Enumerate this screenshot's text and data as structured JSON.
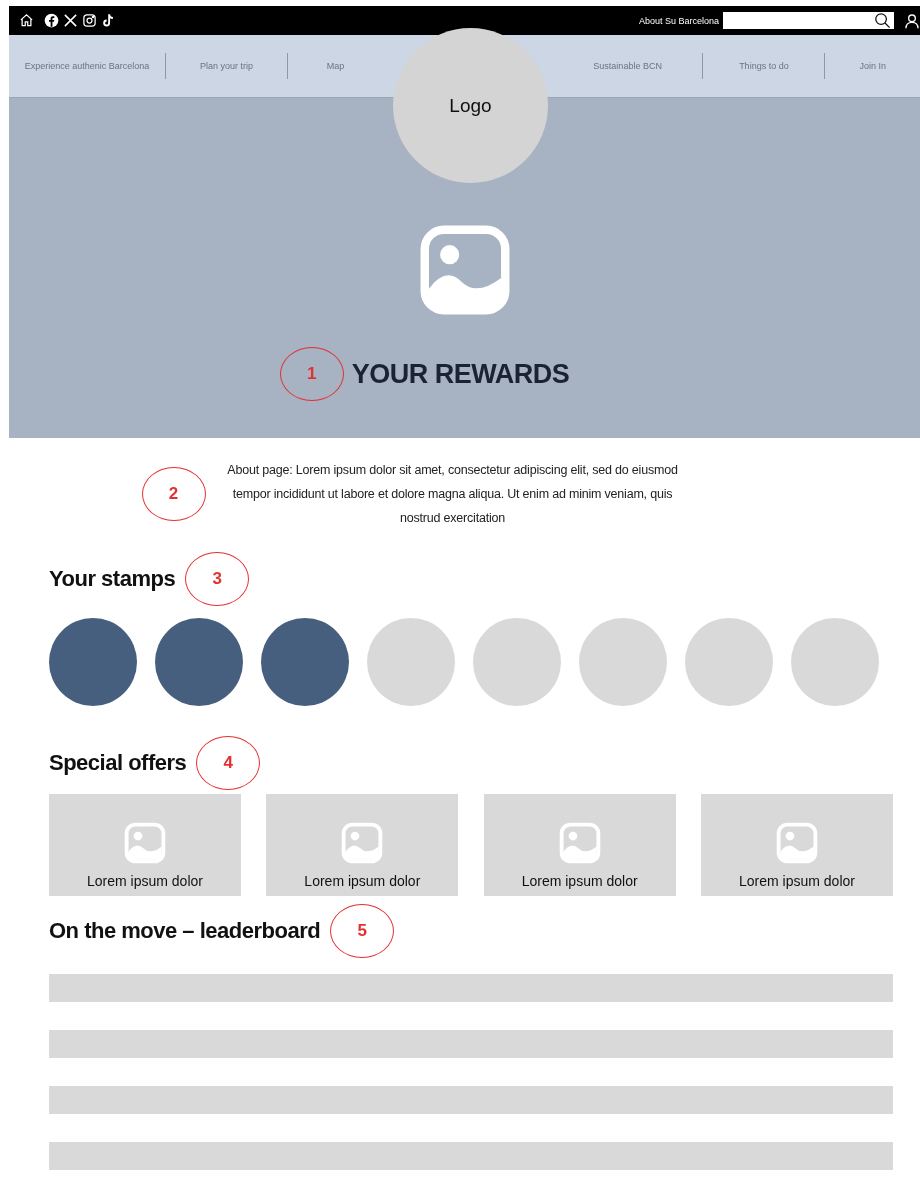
{
  "top_bar": {
    "link": "About Su Barcelona"
  },
  "nav": {
    "items": [
      {
        "label": "Experience authenic Barcelona"
      },
      {
        "label": "Plan your trip"
      },
      {
        "label": "Map"
      },
      {
        "label": "Sustainable BCN"
      },
      {
        "label": "Things to do"
      },
      {
        "label": "Join In"
      }
    ],
    "logo": "Logo"
  },
  "hero": {
    "title": "YOUR REWARDS",
    "callout": "1"
  },
  "about": {
    "text": "About page: Lorem ipsum dolor sit amet, consectetur adipiscing elit, sed do eiusmod tempor incididunt ut labore et dolore magna aliqua. Ut enim ad minim veniam, quis nostrud exercitation",
    "callout": "2"
  },
  "stamps": {
    "title": "Your stamps",
    "callout": "3",
    "items": [
      {
        "filled": true
      },
      {
        "filled": true
      },
      {
        "filled": true
      },
      {
        "filled": false
      },
      {
        "filled": false
      },
      {
        "filled": false
      },
      {
        "filled": false
      },
      {
        "filled": false
      }
    ]
  },
  "offers": {
    "title": "Special offers",
    "callout": "4",
    "items": [
      {
        "label": "Lorem ipsum dolor"
      },
      {
        "label": "Lorem ipsum dolor"
      },
      {
        "label": "Lorem ipsum dolor"
      },
      {
        "label": "Lorem ipsum dolor"
      }
    ]
  },
  "leaderboard": {
    "title": "On the move – leaderboard",
    "callout": "5",
    "rows": [
      {
        "kind": "bar"
      },
      {
        "kind": "bar"
      },
      {
        "kind": "bar"
      },
      {
        "kind": "bar"
      }
    ]
  }
}
